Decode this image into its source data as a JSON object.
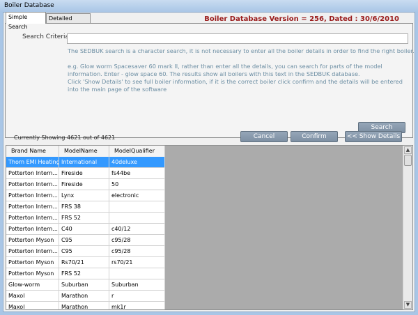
{
  "window": {
    "title": "Boiler Database"
  },
  "tabs": [
    {
      "label": "Simple Search",
      "active": true
    },
    {
      "label": "Detailed Search",
      "active": false
    }
  ],
  "version_text": "Boiler Database Version = 256, Dated : 30/6/2010",
  "search": {
    "label": "Search Criteria",
    "value": "",
    "help_lines": [
      "The SEDBUK search is a character search, it is not necessary to enter all the boiler details in order to find the right boiler.",
      "",
      "e.g. Glow worm Spacesaver 60 mark II, rather than enter all the details, you can search for parts of the model",
      "information. Enter - glow space 60. The results show all boilers with this text in the SEDBUK database.",
      "Click 'Show Details' to see full boiler information, if it is the correct boiler click confirm and the details will be entered",
      "into the main page of the software"
    ],
    "button_label": "Search"
  },
  "status": {
    "showing_text": "Currently Showing 4621 out of 4621"
  },
  "actions": {
    "cancel_label": "Cancel",
    "confirm_label": "Confirm",
    "show_details_label": "<< Show Details"
  },
  "table": {
    "columns": [
      "Brand Name",
      "ModelName",
      "ModelQualifier"
    ],
    "rows": [
      [
        "Thorn EMI Heating",
        "International",
        "40deluxe"
      ],
      [
        "Potterton Intern...",
        "Fireside",
        "fs44be"
      ],
      [
        "Potterton Intern...",
        "Fireside",
        "50"
      ],
      [
        "Potterton Intern...",
        "Lynx",
        "electronic"
      ],
      [
        "Potterton Intern...",
        "FRS 38",
        ""
      ],
      [
        "Potterton Intern...",
        "FRS 52",
        ""
      ],
      [
        "Potterton Intern...",
        "C40",
        "c40/12"
      ],
      [
        "Potterton Myson",
        "C95",
        "c95/28"
      ],
      [
        "Potterton Intern...",
        "C95",
        "c95/28"
      ],
      [
        "Potterton Myson",
        "Rs70/21",
        "rs70/21"
      ],
      [
        "Potterton Myson",
        "FRS 52",
        ""
      ],
      [
        "Glow-worm",
        "Suburban",
        "Suburban"
      ],
      [
        "Maxol",
        "Marathon",
        "r"
      ],
      [
        "Maxol",
        "Marathon",
        "mk1r"
      ]
    ],
    "selected_row": 0
  },
  "colors": {
    "accent_selection": "#3399ff",
    "version_text": "#9a1b1b",
    "help_text": "#6c8ea3",
    "button": "#8797a9"
  }
}
